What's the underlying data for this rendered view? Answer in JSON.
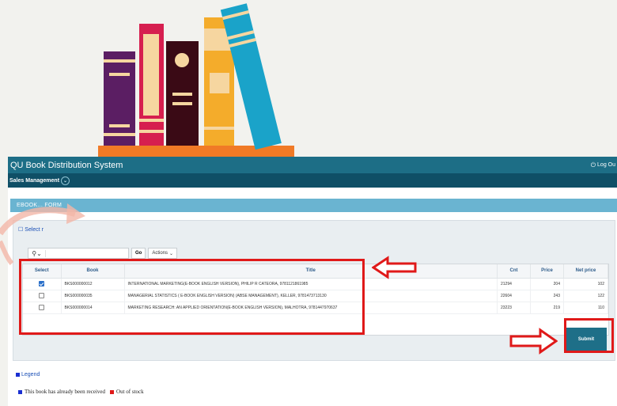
{
  "app": {
    "title": "QU Book Distribution System",
    "logout_label": "Log Ou",
    "nav": {
      "sales_management": "Sales Management"
    }
  },
  "section": {
    "title": "EBOOK... FORM"
  },
  "panel": {
    "select_link": "Select r",
    "search": {
      "value": "",
      "placeholder": ""
    },
    "go_label": "Go",
    "actions_label": "Actions"
  },
  "table": {
    "headers": {
      "select": "Select",
      "book": "Book",
      "title": "Title",
      "cnt": "Cnt",
      "price": "Price",
      "net_price": "Net price"
    },
    "rows": [
      {
        "checked": true,
        "book": "BKS000000012",
        "title": "INTERNATIONAL MARKETING(E-BOOK ENGLISH VERSION), PHILIP R CATEORA, 9781121861985",
        "cnt": "21294",
        "price": "204",
        "net_price": "102"
      },
      {
        "checked": false,
        "book": "BKS000000035",
        "title": "MANAGERIAL STATISTICS ( E-BOOK ENGLISH VERSION) (ABSE MANAGEMENT), KELLER, 9781473713130",
        "cnt": "22604",
        "price": "243",
        "net_price": "122"
      },
      {
        "checked": false,
        "book": "BKS000000014",
        "title": "MARKETING RESEARCH: AN APPLIED ORIENTATION(E-BOOK ENGLISH VERSION), MALHOTRA, 9781447970637",
        "cnt": "23223",
        "price": "219",
        "net_price": "110"
      }
    ]
  },
  "submit_label": "Submit",
  "legend": {
    "title": "Legend",
    "received": "This book has already been received",
    "out_of_stock": "Out of stock",
    "colors": {
      "received": "#1a2fd1",
      "out_of_stock": "#e01919"
    }
  },
  "colors": {
    "header": "#1d6e86",
    "nav": "#0f4f66",
    "section": "#6ab4d1",
    "annotation": "#e01919"
  }
}
